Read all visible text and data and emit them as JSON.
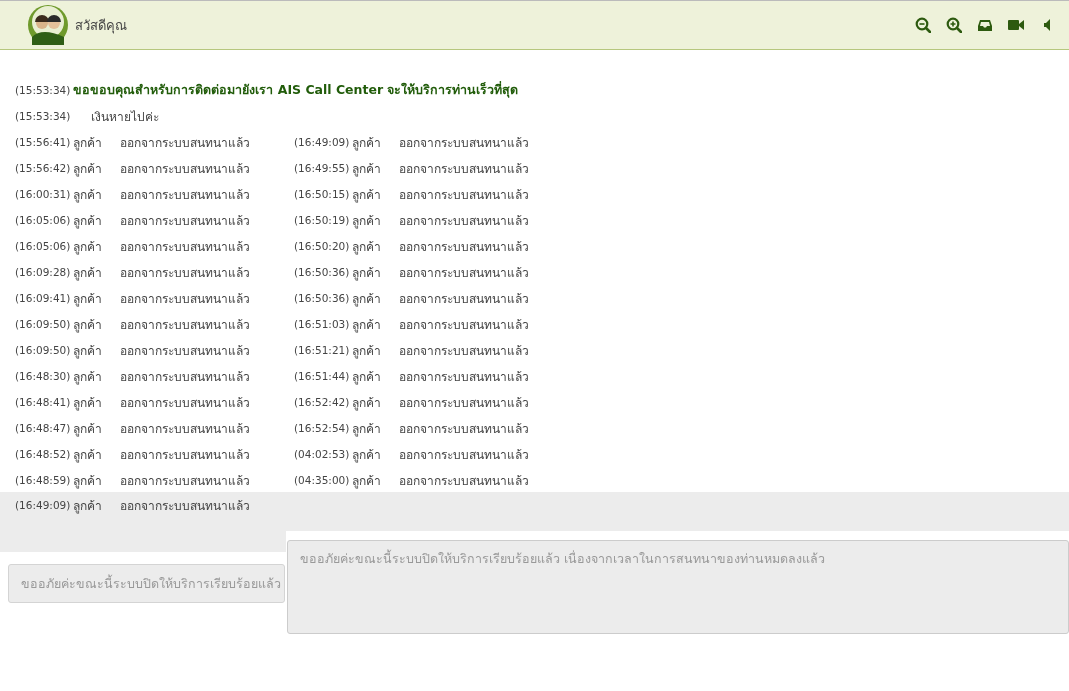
{
  "header": {
    "greeting": "สวัสดีคุณ",
    "tools": [
      {
        "kind": "zoom-out"
      },
      {
        "kind": "zoom-in"
      },
      {
        "kind": "inbox"
      },
      {
        "kind": "video"
      },
      {
        "kind": "sound"
      }
    ]
  },
  "chat": {
    "intro": [
      {
        "time": "(15:53:34)",
        "text": "ขอขอบคุณสำหรับการติดต่อมายังเรา AIS Call Center จะให้บริการท่านเร็วที่สุด",
        "kind": "agent"
      },
      {
        "time": "(15:53:34)",
        "text": "เงินหายไปค่ะ",
        "kind": "customer"
      }
    ],
    "columns": [
      [
        {
          "time": "(15:56:41)",
          "who": "ลูกค้า",
          "text": "ออกจากระบบสนทนาแล้ว"
        },
        {
          "time": "(15:56:42)",
          "who": "ลูกค้า",
          "text": "ออกจากระบบสนทนาแล้ว"
        },
        {
          "time": "(16:00:31)",
          "who": "ลูกค้า",
          "text": "ออกจากระบบสนทนาแล้ว"
        },
        {
          "time": "(16:05:06)",
          "who": "ลูกค้า",
          "text": "ออกจากระบบสนทนาแล้ว"
        },
        {
          "time": "(16:05:06)",
          "who": "ลูกค้า",
          "text": "ออกจากระบบสนทนาแล้ว"
        },
        {
          "time": "(16:09:28)",
          "who": "ลูกค้า",
          "text": "ออกจากระบบสนทนาแล้ว"
        },
        {
          "time": "(16:09:41)",
          "who": "ลูกค้า",
          "text": "ออกจากระบบสนทนาแล้ว"
        },
        {
          "time": "(16:09:50)",
          "who": "ลูกค้า",
          "text": "ออกจากระบบสนทนาแล้ว"
        },
        {
          "time": "(16:09:50)",
          "who": "ลูกค้า",
          "text": "ออกจากระบบสนทนาแล้ว"
        },
        {
          "time": "(16:48:30)",
          "who": "ลูกค้า",
          "text": "ออกจากระบบสนทนาแล้ว"
        },
        {
          "time": "(16:48:41)",
          "who": "ลูกค้า",
          "text": "ออกจากระบบสนทนาแล้ว"
        },
        {
          "time": "(16:48:47)",
          "who": "ลูกค้า",
          "text": "ออกจากระบบสนทนาแล้ว"
        },
        {
          "time": "(16:48:52)",
          "who": "ลูกค้า",
          "text": "ออกจากระบบสนทนาแล้ว"
        },
        {
          "time": "(16:48:59)",
          "who": "ลูกค้า",
          "text": "ออกจากระบบสนทนาแล้ว"
        }
      ],
      [
        {
          "time": "(16:49:09)",
          "who": "ลูกค้า",
          "text": "ออกจากระบบสนทนาแล้ว"
        },
        {
          "time": "(16:49:55)",
          "who": "ลูกค้า",
          "text": "ออกจากระบบสนทนาแล้ว"
        },
        {
          "time": "(16:50:15)",
          "who": "ลูกค้า",
          "text": "ออกจากระบบสนทนาแล้ว"
        },
        {
          "time": "(16:50:19)",
          "who": "ลูกค้า",
          "text": "ออกจากระบบสนทนาแล้ว"
        },
        {
          "time": "(16:50:20)",
          "who": "ลูกค้า",
          "text": "ออกจากระบบสนทนาแล้ว"
        },
        {
          "time": "(16:50:36)",
          "who": "ลูกค้า",
          "text": "ออกจากระบบสนทนาแล้ว"
        },
        {
          "time": "(16:50:36)",
          "who": "ลูกค้า",
          "text": "ออกจากระบบสนทนาแล้ว"
        },
        {
          "time": "(16:51:03)",
          "who": "ลูกค้า",
          "text": "ออกจากระบบสนทนาแล้ว"
        },
        {
          "time": "(16:51:21)",
          "who": "ลูกค้า",
          "text": "ออกจากระบบสนทนาแล้ว"
        },
        {
          "time": "(16:51:44)",
          "who": "ลูกค้า",
          "text": "ออกจากระบบสนทนาแล้ว"
        },
        {
          "time": "(16:52:42)",
          "who": "ลูกค้า",
          "text": "ออกจากระบบสนทนาแล้ว"
        },
        {
          "time": "(16:52:54)",
          "who": "ลูกค้า",
          "text": "ออกจากระบบสนทนาแล้ว"
        },
        {
          "time": "(04:02:53)",
          "who": "ลูกค้า",
          "text": "ออกจากระบบสนทนาแล้ว"
        },
        {
          "time": "(04:35:00)",
          "who": "ลูกค้า",
          "text": "ออกจากระบบสนทนาแล้ว"
        }
      ]
    ],
    "last": {
      "time": "(16:49:09)",
      "who": "ลูกค้า",
      "text": "ออกจากระบบสนทนาแล้ว"
    }
  },
  "inputs": {
    "small": {
      "placeholder": "ขออภัยค่ะขณะนี้ระบบปิดให้บริการเรียบร้อยแล้ว",
      "disabled": true
    },
    "main": {
      "placeholder": "ขออภัยค่ะขณะนี้ระบบปิดให้บริการเรียบร้อยแล้ว เนื่องจากเวลาในการสนทนาของท่านหมดลงแล้ว",
      "disabled": true
    }
  }
}
